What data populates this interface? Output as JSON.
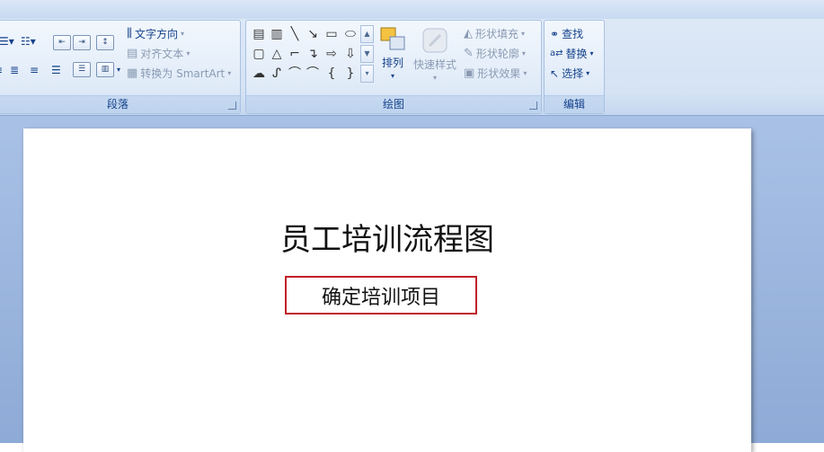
{
  "ribbon": {
    "paragraph_group": {
      "label": "段落",
      "text_direction": "文字方向",
      "align_text": "对齐文本",
      "convert_smartart": "转换为 SmartArt"
    },
    "drawing_group": {
      "label": "绘图",
      "arrange": "排列",
      "quick_styles": "快速样式",
      "shape_fill": "形状填充",
      "shape_outline": "形状轮廓",
      "shape_effects": "形状效果"
    },
    "editing_group": {
      "label": "编辑",
      "find": "查找",
      "replace": "替换",
      "select": "选择"
    }
  },
  "slide": {
    "title": "员工培训流程图",
    "box_text": "确定培训项目",
    "box_border_color": "#c0202a"
  }
}
